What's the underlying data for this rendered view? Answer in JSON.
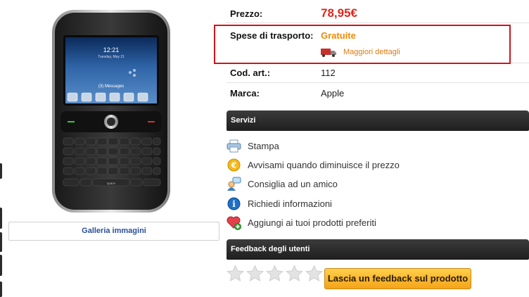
{
  "details": {
    "price_label": "Prezzo:",
    "price_value": "78,95€",
    "shipping_label": "Spese di trasporto:",
    "shipping_value": "Gratuite",
    "shipping_more": "Maggiori dettagli",
    "code_label": "Cod. art.:",
    "code_value": "112",
    "brand_label": "Marca:",
    "brand_value": "Apple"
  },
  "gallery": {
    "label": "Galleria immagini"
  },
  "phone_screen": {
    "time": "12:21",
    "date": "Tuesday, May 21",
    "messages": "(3) Messages",
    "space_key": "space"
  },
  "services": {
    "title": "Servizi",
    "items": [
      {
        "label": "Stampa",
        "icon": "printer-icon"
      },
      {
        "label": "Avvisami quando diminuisce il prezzo",
        "icon": "euro-coin-icon"
      },
      {
        "label": "Consiglia ad un amico",
        "icon": "recommend-friend-icon"
      },
      {
        "label": "Richiedi informazioni",
        "icon": "info-icon"
      },
      {
        "label": "Aggiungi ai tuoi prodotti preferiti",
        "icon": "heart-plus-icon"
      }
    ]
  },
  "feedback": {
    "title": "Feedback degli utenti",
    "rating": 0,
    "max_rating": 5,
    "button_label": "Lascia un feedback sul prodotto"
  },
  "colors": {
    "price": "#e0251b",
    "free_shipping": "#f08a00",
    "highlight_box": "#d0141b",
    "section_bar": "#2a2a2a",
    "link_blue": "#2a4f9c"
  }
}
